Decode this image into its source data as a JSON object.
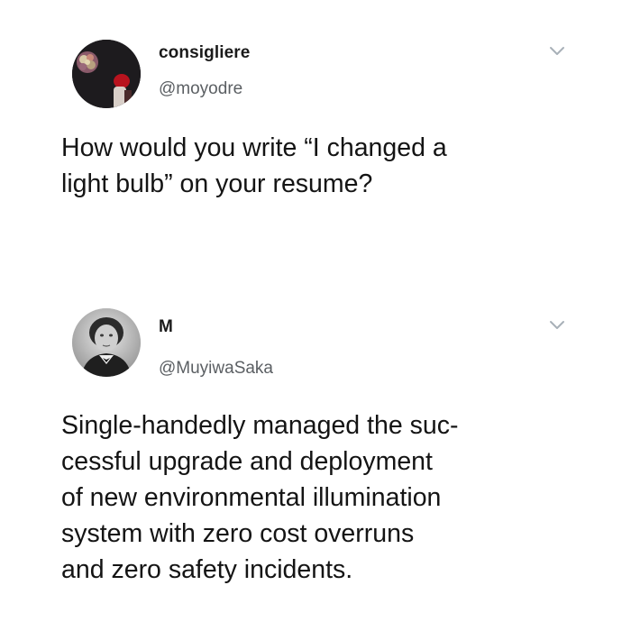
{
  "tweets": [
    {
      "display_name": "consigliere",
      "handle": "@moyodre",
      "avatar_icon": "red-flower-portrait-avatar",
      "menu_icon": "chevron-down-icon",
      "body_lines": [
        "How would you write “I changed a",
        "light bulb” on your resume?"
      ]
    },
    {
      "display_name": "M",
      "handle": "@MuyiwaSaka",
      "avatar_icon": "vintage-portrait-avatar",
      "menu_icon": "chevron-down-icon",
      "body_lines": [
        "Single-handedly managed the suc-",
        "cessful upgrade and deployment",
        "of new environmental illumination",
        "system with zero cost overruns",
        "and zero safety incidents."
      ]
    }
  ],
  "colors": {
    "background": "#ffffff",
    "text": "#141414",
    "handle": "#5b5f63",
    "chevron": "#a8b0b8"
  }
}
